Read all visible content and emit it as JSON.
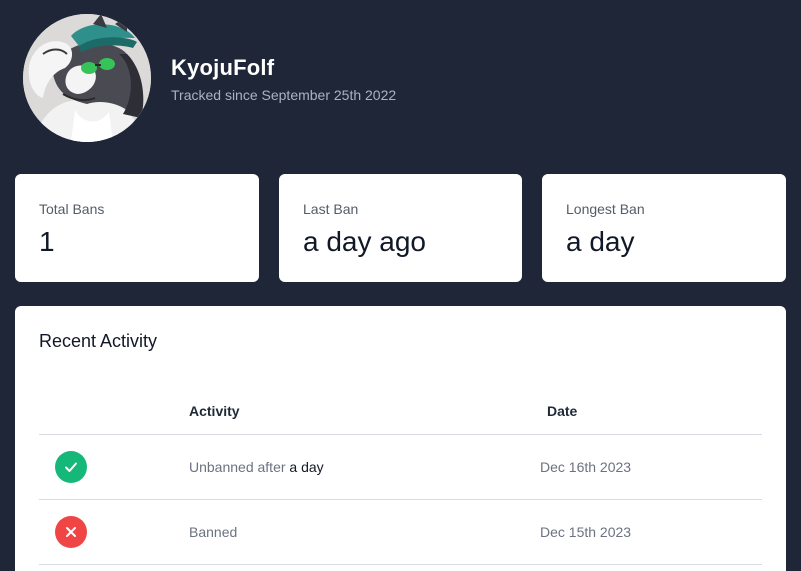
{
  "profile": {
    "username": "KyojuFolf",
    "tracked_since": "Tracked since September 25th 2022",
    "avatar_icon": "wolf-avatar"
  },
  "stats": [
    {
      "label": "Total Bans",
      "value": "1"
    },
    {
      "label": "Last Ban",
      "value": "a day ago"
    },
    {
      "label": "Longest Ban",
      "value": "a day"
    }
  ],
  "activity": {
    "title": "Recent Activity",
    "columns": {
      "activity": "Activity",
      "date": "Date"
    },
    "rows": [
      {
        "status": "unbanned",
        "icon": "check-icon",
        "text": "Unbanned after",
        "emphasis": "a day",
        "date": "Dec 16th 2023"
      },
      {
        "status": "banned",
        "icon": "x-icon",
        "text": "Banned",
        "emphasis": "",
        "date": "Dec 15th 2023"
      }
    ]
  },
  "colors": {
    "background": "#1e2637",
    "success": "#16b87a",
    "danger": "#ef4545"
  }
}
